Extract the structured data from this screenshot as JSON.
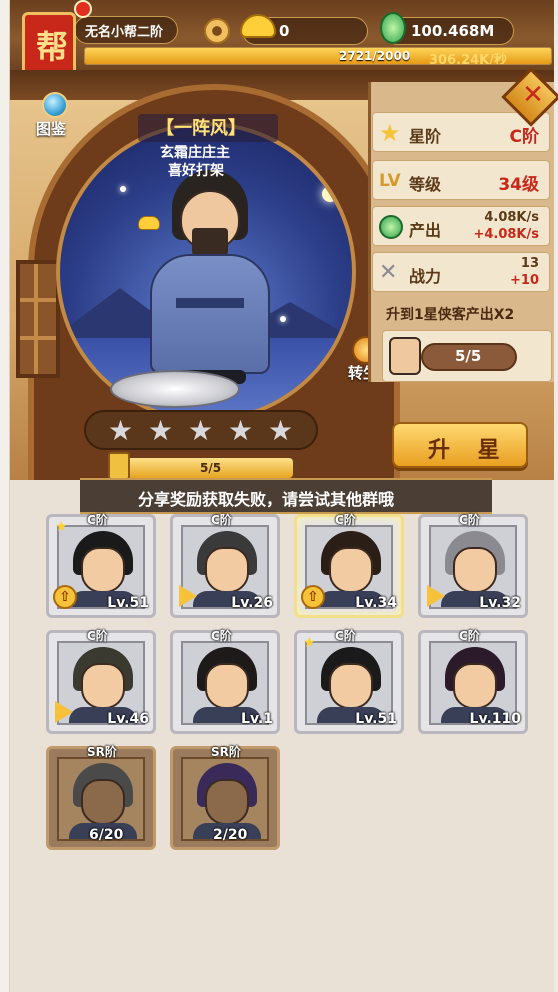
{
  "player": {
    "guild_badge_char": "帮",
    "rank_name": "无名小帮二阶",
    "gold_ingots": "0",
    "jade_amount": "100.468M",
    "xp_text": "2721/2000",
    "income_rate": "306.24K/秒",
    "xp_fraction": 1.0
  },
  "hero": {
    "name": "【一阵风】",
    "title_line_1": "玄霜庄庄主",
    "title_line_2": "喜好打架",
    "atlas_label": "图鉴",
    "rebirth_label": "转生"
  },
  "stats": [
    {
      "icon": "star-icon",
      "label": "星阶",
      "value": "C阶"
    },
    {
      "icon": "level-icon",
      "label": "等级",
      "value": "34级"
    },
    {
      "icon": "jade-icon",
      "label": "产出",
      "value_line_1": "4.08K/s",
      "value_line_2": "+4.08K/s"
    },
    {
      "icon": "crossed-swords-icon",
      "label": "战力",
      "value_line_1": "13",
      "value_line_2": "+10"
    }
  ],
  "upgrade_tip": "升到1星侠客产出X2",
  "rebirth_progress": "5/5",
  "star_bar": {
    "total_stars": 5,
    "filled_stars": 0
  },
  "upgrade_button_label": "升 星",
  "star_progress_text": "5/5",
  "star_progress_fraction": 0.97,
  "share_banner": "分享奖励获取失败，请尝试其他群哦",
  "roster": [
    {
      "rank": "C阶",
      "level": "Lv.51",
      "badge": "up",
      "star": true,
      "highlight": false
    },
    {
      "rank": "C阶",
      "level": "Lv.26",
      "badge": "play",
      "star": false,
      "highlight": false
    },
    {
      "rank": "C阶",
      "level": "Lv.34",
      "badge": "up",
      "star": false,
      "highlight": true
    },
    {
      "rank": "C阶",
      "level": "Lv.32",
      "badge": "play",
      "star": false,
      "highlight": false
    },
    {
      "rank": "C阶",
      "level": "Lv.46",
      "badge": "play",
      "star": false,
      "highlight": false
    },
    {
      "rank": "C阶",
      "level": "Lv.1",
      "badge": "",
      "star": false,
      "highlight": false
    },
    {
      "rank": "C阶",
      "level": "Lv.51",
      "badge": "",
      "star": true,
      "highlight": false
    },
    {
      "rank": "C阶",
      "level": "Lv.110",
      "badge": "",
      "star": false,
      "highlight": false
    },
    {
      "rank": "SR阶",
      "fragments": "6/20",
      "sr": true
    },
    {
      "rank": "SR阶",
      "fragments": "2/20",
      "sr": true
    }
  ],
  "colors": {
    "accent_red": "#c8281a",
    "gold": "#f5c23a",
    "wood": "#8a5a2e"
  }
}
